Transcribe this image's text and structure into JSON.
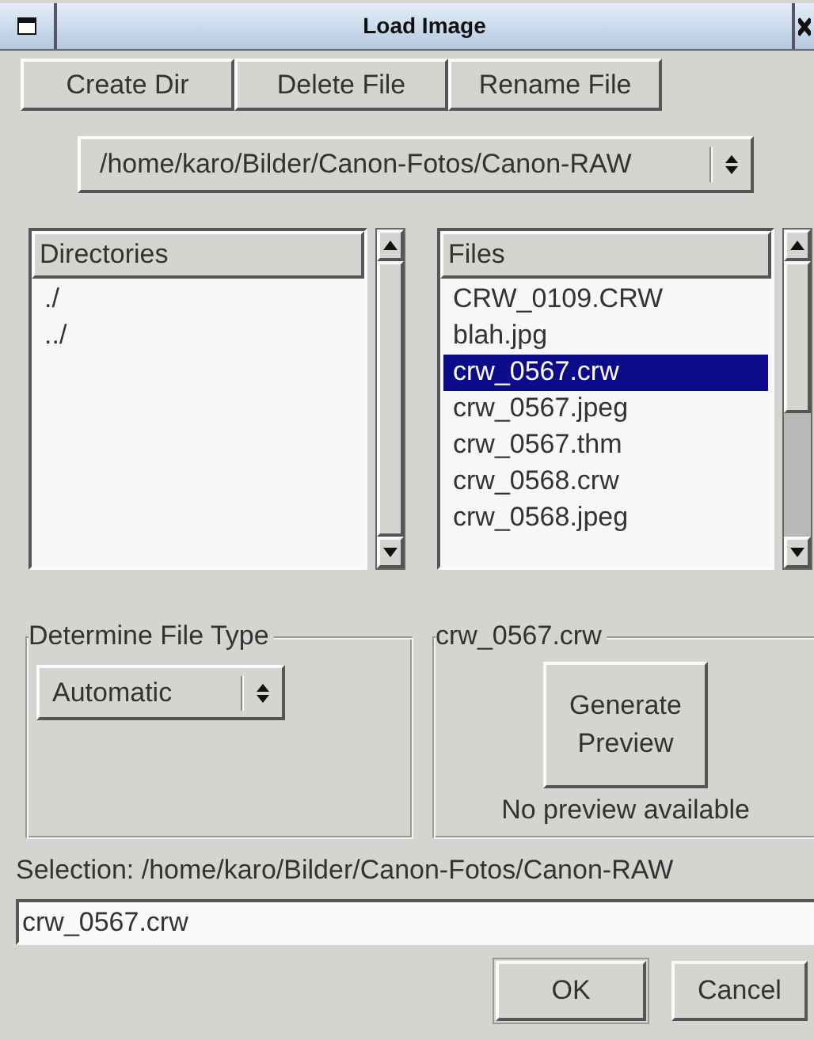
{
  "window": {
    "title": "Load Image"
  },
  "toolbar": [
    {
      "label": "Create Dir"
    },
    {
      "label": "Delete File"
    },
    {
      "label": "Rename File"
    }
  ],
  "path_combo": {
    "value": "/home/karo/Bilder/Canon-Fotos/Canon-RAW"
  },
  "directories": {
    "header": "Directories",
    "items": [
      {
        "label": "./",
        "selected": false
      },
      {
        "label": "../",
        "selected": false
      }
    ]
  },
  "files": {
    "header": "Files",
    "items": [
      {
        "label": "CRW_0109.CRW",
        "selected": false
      },
      {
        "label": "blah.jpg",
        "selected": false
      },
      {
        "label": "crw_0567.crw",
        "selected": true
      },
      {
        "label": "crw_0567.jpeg",
        "selected": false
      },
      {
        "label": "crw_0567.thm",
        "selected": false
      },
      {
        "label": "crw_0568.crw",
        "selected": false
      },
      {
        "label": "crw_0568.jpeg",
        "selected": false
      }
    ]
  },
  "file_type": {
    "title": "Determine File Type",
    "value": "Automatic"
  },
  "preview": {
    "title": "crw_0567.crw",
    "button": "Generate Preview",
    "status": "No preview available"
  },
  "selection": {
    "label": "Selection: /home/karo/Bilder/Canon-Fotos/Canon-RAW",
    "value": "crw_0567.crw"
  },
  "buttons": [
    {
      "label": "OK",
      "default": true
    },
    {
      "label": "Cancel",
      "default": false
    }
  ]
}
